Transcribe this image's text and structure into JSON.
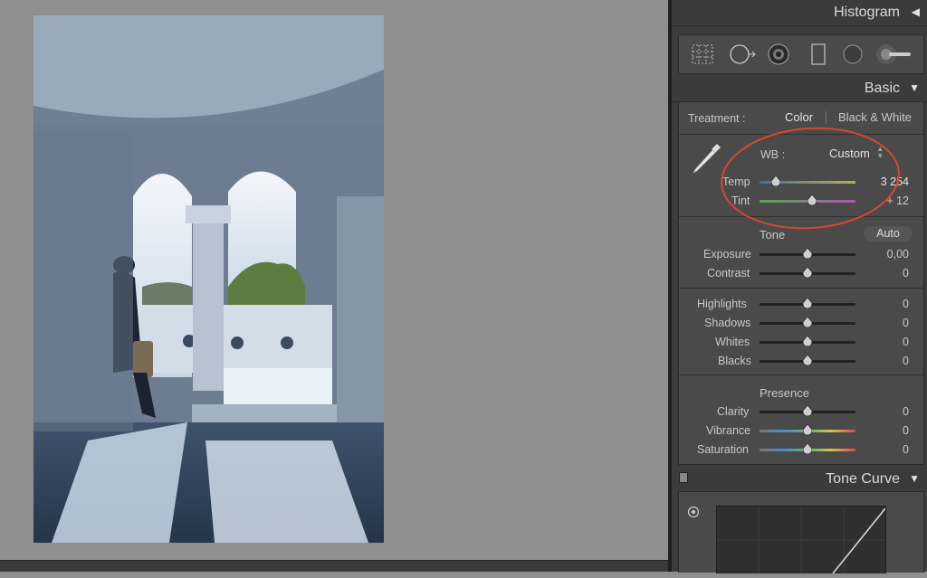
{
  "panel": {
    "histogram_label": "Histogram",
    "basic_label": "Basic",
    "tone_curve_label": "Tone Curve"
  },
  "tools": [
    "grid-crop-icon",
    "spot-removal-icon",
    "red-eye-icon",
    "graduated-filter-icon",
    "radial-filter-icon",
    "adjustment-brush-icon"
  ],
  "treatment": {
    "label": "Treatment :",
    "color": "Color",
    "bw": "Black & White"
  },
  "wb": {
    "label": "WB :",
    "value": "Custom",
    "temp_label": "Temp",
    "temp_value": "3 254",
    "tint_label": "Tint",
    "tint_value": "+ 12"
  },
  "tone": {
    "label": "Tone",
    "auto": "Auto",
    "exposure_label": "Exposure",
    "exposure_value": "0,00",
    "contrast_label": "Contrast",
    "contrast_value": "0",
    "highlights_label": "Highlights",
    "highlights_value": "0",
    "shadows_label": "Shadows",
    "shadows_value": "0",
    "whites_label": "Whites",
    "whites_value": "0",
    "blacks_label": "Blacks",
    "blacks_value": "0"
  },
  "presence": {
    "label": "Presence",
    "clarity_label": "Clarity",
    "clarity_value": "0",
    "vibrance_label": "Vibrance",
    "vibrance_value": "0",
    "saturation_label": "Saturation",
    "saturation_value": "0"
  },
  "colors": {
    "annotation": "#d9482b",
    "panel_bg": "#3b3b3b",
    "section_bg": "#4a4a4a"
  }
}
